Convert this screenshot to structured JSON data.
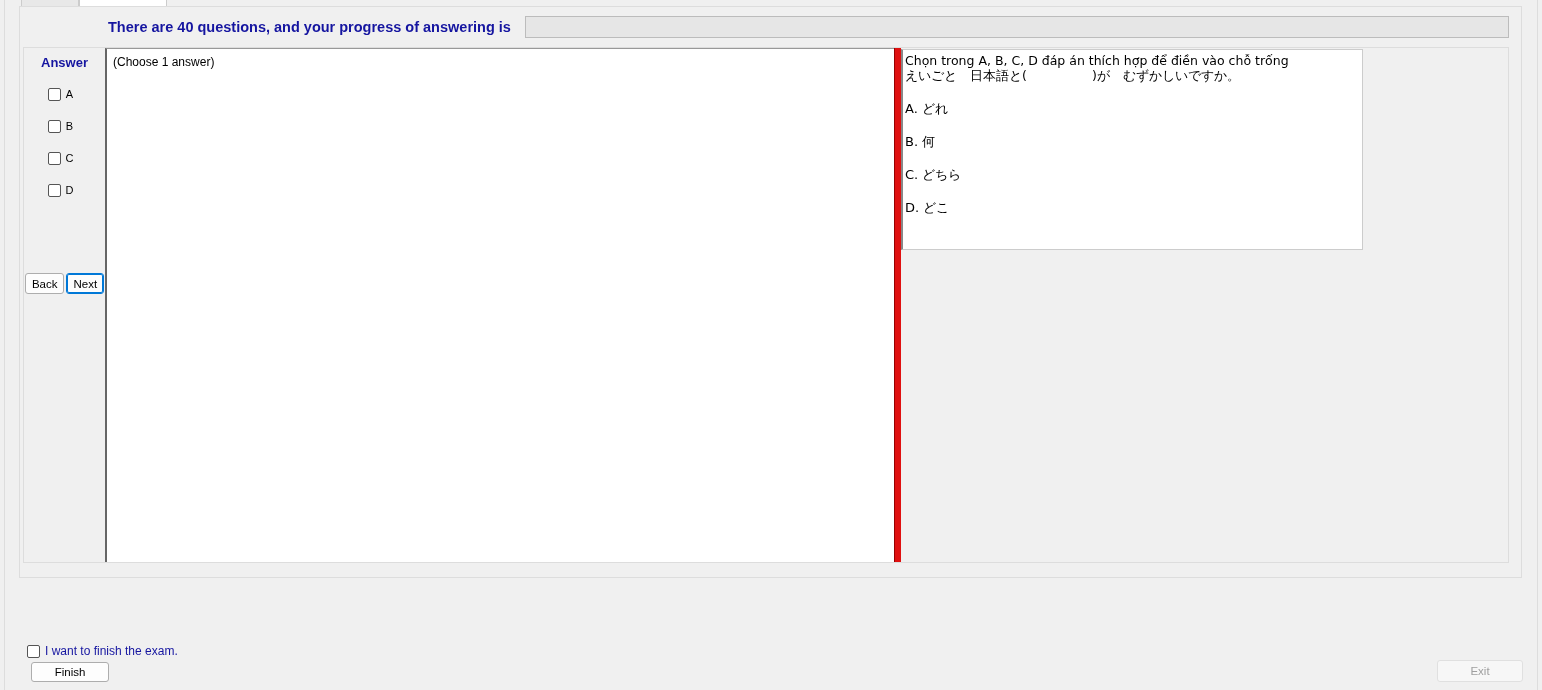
{
  "tabs": [
    {
      "selected": false
    },
    {
      "selected": true
    }
  ],
  "header": {
    "text": "There are 40 questions, and your progress of answering is",
    "progress": {
      "level": 0
    }
  },
  "answer_panel": {
    "title": "Answer",
    "options": [
      {
        "label": "A",
        "checked": false
      },
      {
        "label": "B",
        "checked": false
      },
      {
        "label": "C",
        "checked": false
      },
      {
        "label": "D",
        "checked": false
      }
    ],
    "buttons": [
      {
        "label": "Back",
        "focused": false
      },
      {
        "label": "Next",
        "focused": true
      }
    ]
  },
  "answer_box": {
    "text": "(Choose 1 answer)"
  },
  "question": {
    "lines": [
      "Chọn trong A, B, C, D đáp án thích hợp để điền vào chỗ trống",
      "えいごと　日本語と(　　　　　)が　むずかしいですか。"
    ],
    "choices": [
      "A.  どれ",
      "B.  何",
      "C.  どちら",
      "D.  どこ"
    ]
  },
  "finish": {
    "checkbox": {
      "label": "I want to finish the exam.",
      "checked": false
    },
    "button": {
      "label": "Finish",
      "disabled": false
    }
  },
  "exit_button": {
    "label": "Exit",
    "disabled": true
  }
}
